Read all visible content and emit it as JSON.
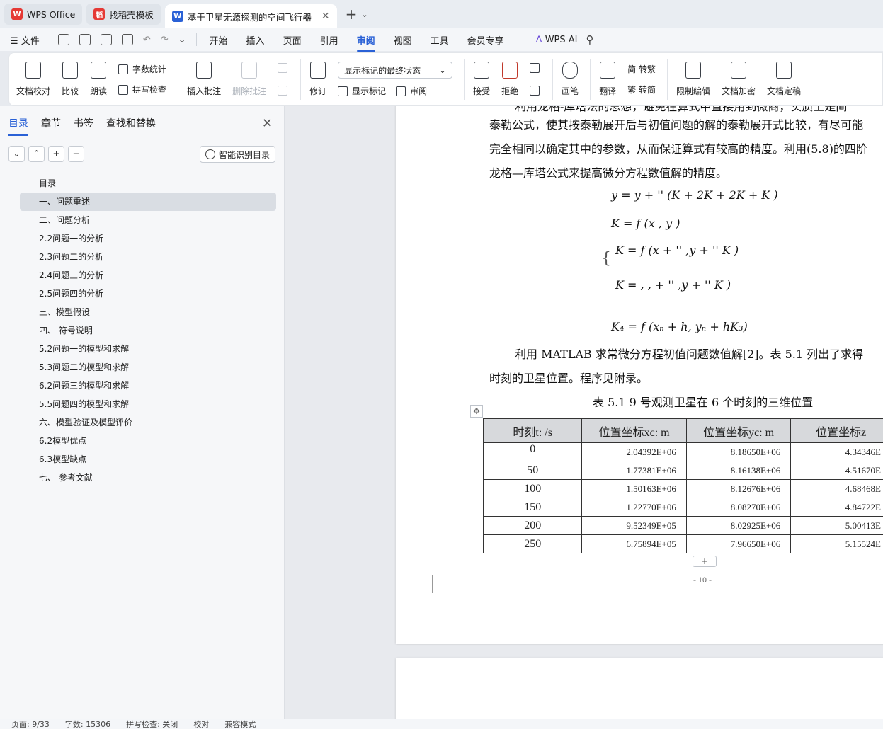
{
  "tabs": [
    {
      "label": "WPS Office",
      "logo": "W",
      "color": "#e53935"
    },
    {
      "label": "找稻壳模板",
      "logo": "稻",
      "color": "#e53935"
    },
    {
      "label": "基于卫星无源探测的空间飞行器",
      "logo": "W",
      "color": "#2a61d6"
    }
  ],
  "menubar": {
    "file": "文件",
    "items": [
      "开始",
      "插入",
      "页面",
      "引用",
      "审阅",
      "视图",
      "工具",
      "会员专享"
    ],
    "active": "审阅",
    "ai": "WPS AI"
  },
  "ribbon": {
    "proofread": "文档校对",
    "compare": "比较",
    "read_aloud": "朗读",
    "word_count": "字数统计",
    "spell_check": "拼写检查",
    "insert_comment": "插入批注",
    "delete_comment": "删除批注",
    "revise": "修订",
    "markup_state": "显示标记的最终状态",
    "show_markup": "显示标记",
    "review": "审阅",
    "accept": "接受",
    "reject": "拒绝",
    "pen": "画笔",
    "translate": "翻译",
    "to_traditional": "简 转繁",
    "to_simplified": "繁 转简",
    "restrict_edit": "限制编辑",
    "encrypt": "文档加密",
    "finalize": "文档定稿"
  },
  "sidebar": {
    "tabs": [
      "目录",
      "章节",
      "书签",
      "查找和替换"
    ],
    "active_tab": "目录",
    "smart_toc": "智能识别目录",
    "toc": [
      {
        "label": "目录",
        "selected": false
      },
      {
        "label": "一、问题重述",
        "selected": true
      },
      {
        "label": "二、问题分析",
        "selected": false
      },
      {
        "label": "2.2问题一的分析",
        "selected": false
      },
      {
        "label": "2.3问题二的分析",
        "selected": false
      },
      {
        "label": "2.4问题三的分析",
        "selected": false
      },
      {
        "label": "2.5问题四的分析",
        "selected": false
      },
      {
        "label": "三、模型假设",
        "selected": false
      },
      {
        "label": "四、 符号说明",
        "selected": false
      },
      {
        "label": "5.2问题一的模型和求解",
        "selected": false
      },
      {
        "label": "5.3问题二的模型和求解",
        "selected": false
      },
      {
        "label": "6.2问题三的模型和求解",
        "selected": false
      },
      {
        "label": "5.5问题四的模型和求解",
        "selected": false
      },
      {
        "label": "六、模型验证及模型评价",
        "selected": false
      },
      {
        "label": "6.2模型优点",
        "selected": false
      },
      {
        "label": "6.3模型缺点",
        "selected": false
      },
      {
        "label": "七、 参考文献",
        "selected": false
      }
    ]
  },
  "document": {
    "lines": [
      "利用龙格-库塔法的思想，避免在算式中直接用到微商，实质上是间",
      "泰勒公式，使其按泰勒展开后与初值问题的解的泰勒展开式比较，有尽可能",
      "完全相同以确定其中的参数，从而保证算式有较高的精度。利用(5.8)的四阶",
      "龙格—库塔公式来提高微分方程数值解的精度。"
    ],
    "formula": [
      "y    = y + '' (K + 2K + 2K + K )",
      "K = f (x , y )",
      "K = f (x  + '' ,y  + '' K )",
      "K = , , + '' ,y  + '' K )",
      "K₄ = f (xₙ + h, yₙ + hK₃)"
    ],
    "after_lines": [
      "利用 MATLAB 求常微分方程初值问题数值解[2]。表 5.1 列出了求得",
      "时刻的卫星位置。程序见附录。"
    ],
    "table_caption": "表 5.1   9 号观测卫星在 6 个时刻的三维位置",
    "table_headers": [
      "时刻t:   /s",
      "位置坐标xc:   m",
      "位置坐标yc:   m",
      "位置坐标z"
    ],
    "table_rows": [
      [
        "0",
        "2.04392E+06",
        "8.18650E+06",
        "4.34346E"
      ],
      [
        "50",
        "1.77381E+06",
        "8.16138E+06",
        "4.51670E"
      ],
      [
        "100",
        "1.50163E+06",
        "8.12676E+06",
        "4.68468E"
      ],
      [
        "150",
        "1.22770E+06",
        "8.08270E+06",
        "4.84722E"
      ],
      [
        "200",
        "9.52349E+05",
        "8.02925E+06",
        "5.00413E"
      ],
      [
        "250",
        "6.75894E+05",
        "7.96650E+06",
        "5.15524E"
      ]
    ],
    "page_number": "- 10 -"
  },
  "statusbar": {
    "page": "页面: 9/33",
    "words": "字数: 15306",
    "spell": "拼写检查: 关闭",
    "proof": "校对",
    "compat": "兼容模式"
  }
}
